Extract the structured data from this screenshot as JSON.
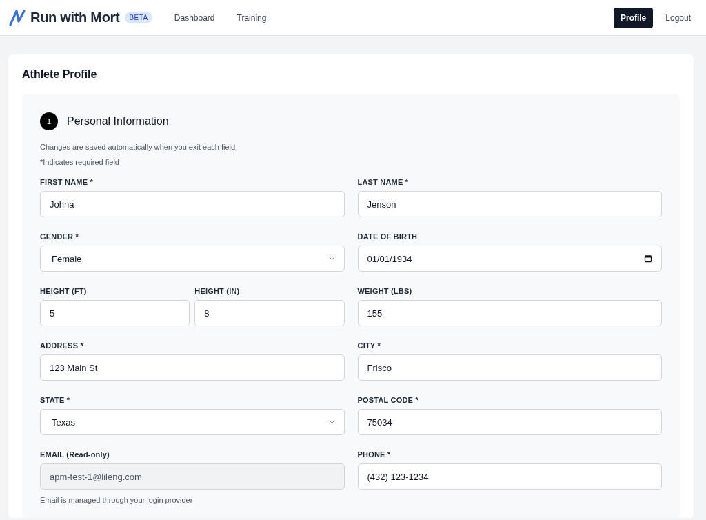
{
  "header": {
    "brand": "Run with Mort",
    "badge": "BETA",
    "nav": [
      {
        "label": "Dashboard",
        "selected": false
      },
      {
        "label": "Training",
        "selected": false
      }
    ],
    "actions": [
      {
        "label": "Profile",
        "selected": true
      },
      {
        "label": "Logout",
        "selected": false
      }
    ]
  },
  "page": {
    "title": "Athlete Profile",
    "section": {
      "step": "1",
      "title": "Personal Information",
      "notes": [
        "Changes are saved automatically when you exit each field.",
        "*Indicates required field"
      ],
      "rows": [
        {
          "columns": [
            [
              {
                "label": "FIRST NAME *",
                "value": "Johna",
                "kind": "text"
              }
            ],
            [
              {
                "label": "LAST NAME *",
                "value": "Jenson",
                "kind": "text"
              }
            ]
          ]
        },
        {
          "columns": [
            [
              {
                "label": "GENDER *",
                "value": "Female",
                "kind": "select"
              }
            ],
            [
              {
                "label": "DATE OF BIRTH",
                "value": "01/01/1934",
                "kind": "date"
              }
            ]
          ]
        },
        {
          "columns": [
            [
              {
                "label": "HEIGHT (FT)",
                "value": "5",
                "kind": "text"
              },
              {
                "label": "HEIGHT (IN)",
                "value": "8",
                "kind": "text"
              }
            ],
            [
              {
                "label": "WEIGHT (LBS)",
                "value": "155",
                "kind": "text"
              }
            ]
          ]
        },
        {
          "columns": [
            [
              {
                "label": "ADDRESS *",
                "value": "123 Main St",
                "kind": "text"
              }
            ],
            [
              {
                "label": "CITY *",
                "value": "Frisco",
                "kind": "text"
              }
            ]
          ]
        },
        {
          "columns": [
            [
              {
                "label": "STATE *",
                "value": "Texas",
                "kind": "select"
              }
            ],
            [
              {
                "label": "POSTAL CODE *",
                "value": "75034",
                "kind": "text"
              }
            ]
          ]
        },
        {
          "columns": [
            [
              {
                "label": "EMAIL (Read-only)",
                "value": "apm-test-1@lileng.com",
                "kind": "readonly",
                "note": "Email is managed through your login provider"
              }
            ],
            [
              {
                "label": "PHONE *",
                "value": "(432) 123-1234",
                "kind": "text"
              }
            ]
          ]
        }
      ]
    }
  }
}
